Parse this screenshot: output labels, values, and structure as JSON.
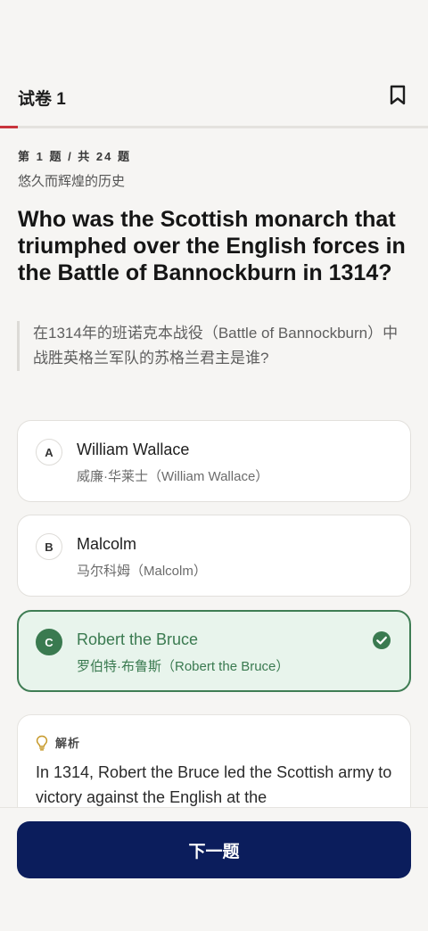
{
  "colors": {
    "accent_red": "#c9353d",
    "correct_green": "#3a7a50",
    "correct_bg": "#e8f4ec",
    "primary_navy": "#0b1d5c"
  },
  "header": {
    "title": "试卷 1",
    "bookmark_icon": "bookmark-icon"
  },
  "progress": {
    "current": 1,
    "total": 24
  },
  "question": {
    "meta": "第 1 题 / 共 24 题",
    "category": "悠久而辉煌的历史",
    "text": "Who was the Scottish monarch that triumphed over the English forces in the Battle of Bannockburn in 1314?",
    "translation": "在1314年的班诺克本战役（Battle of Bannockburn）中战胜英格兰军队的苏格兰君主是谁?"
  },
  "options": [
    {
      "letter": "A",
      "text": "William Wallace",
      "translation": "威廉·华莱士（William Wallace）",
      "state": "normal"
    },
    {
      "letter": "B",
      "text": "Malcolm",
      "translation": "马尔科姆（Malcolm）",
      "state": "normal"
    },
    {
      "letter": "C",
      "text": "Robert the Bruce",
      "translation": "罗伯特·布鲁斯（Robert the Bruce）",
      "state": "correct"
    }
  ],
  "analysis": {
    "icon": "lightbulb-icon",
    "label": "解析",
    "text": "In 1314, Robert the Bruce led the Scottish army to victory against the English at the"
  },
  "footer": {
    "next_label": "下一题"
  }
}
